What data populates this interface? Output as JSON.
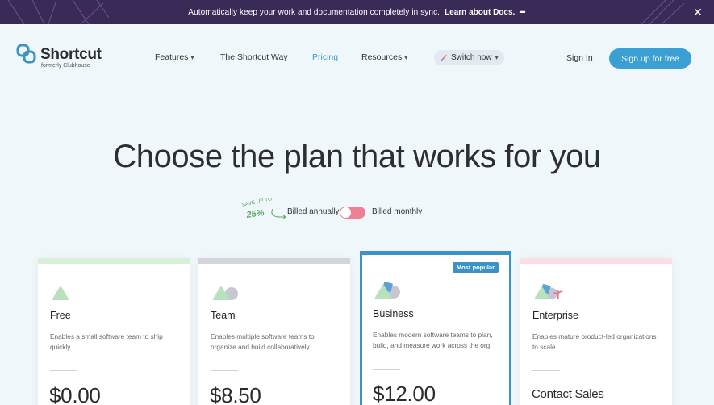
{
  "announcement": {
    "message": "Automatically keep your work and documentation completely in sync.",
    "link": "Learn about Docs.",
    "arrow": "➡",
    "close": "✕"
  },
  "brand": {
    "name": "Shortcut",
    "tagline": "formerly Clubhouse"
  },
  "nav": {
    "features": "Features",
    "shortcut_way": "The Shortcut Way",
    "pricing": "Pricing",
    "resources": "Resources",
    "switch_now": "Switch now",
    "chevron": "⌄",
    "wand": "⚡",
    "sign_in": "Sign In",
    "sign_up": "Sign up for free"
  },
  "hero": {
    "title": "Choose the plan that works for you",
    "save_line1": "SAVE UP TO",
    "save_line2": "25%",
    "billed_annually": "Billed annually",
    "billed_monthly": "Billed monthly",
    "toggle_state": "annually"
  },
  "plans": [
    {
      "name": "Free",
      "description": "Enables a small software team to ship quickly.",
      "price": "$0.00",
      "accent": "#d8efd9"
    },
    {
      "name": "Team",
      "description": "Enables multiple software teams to organize and build collaboratively.",
      "price": "$8.50",
      "accent": "#d4d4db"
    },
    {
      "name": "Business",
      "description": "Enables modern software teams to plan, build, and measure work across the org.",
      "price": "$12.00",
      "accent": "#3a93c4",
      "badge": "Most popular"
    },
    {
      "name": "Enterprise",
      "description": "Enables mature product-led organizations to scale.",
      "price": "Contact Sales",
      "accent": "#fbdde3"
    }
  ],
  "colors": {
    "announcement_bg": "#3a2a58",
    "accent_blue": "#3a9fd3",
    "toggle": "#ef7f93",
    "page_bg": "#eff7fb"
  }
}
